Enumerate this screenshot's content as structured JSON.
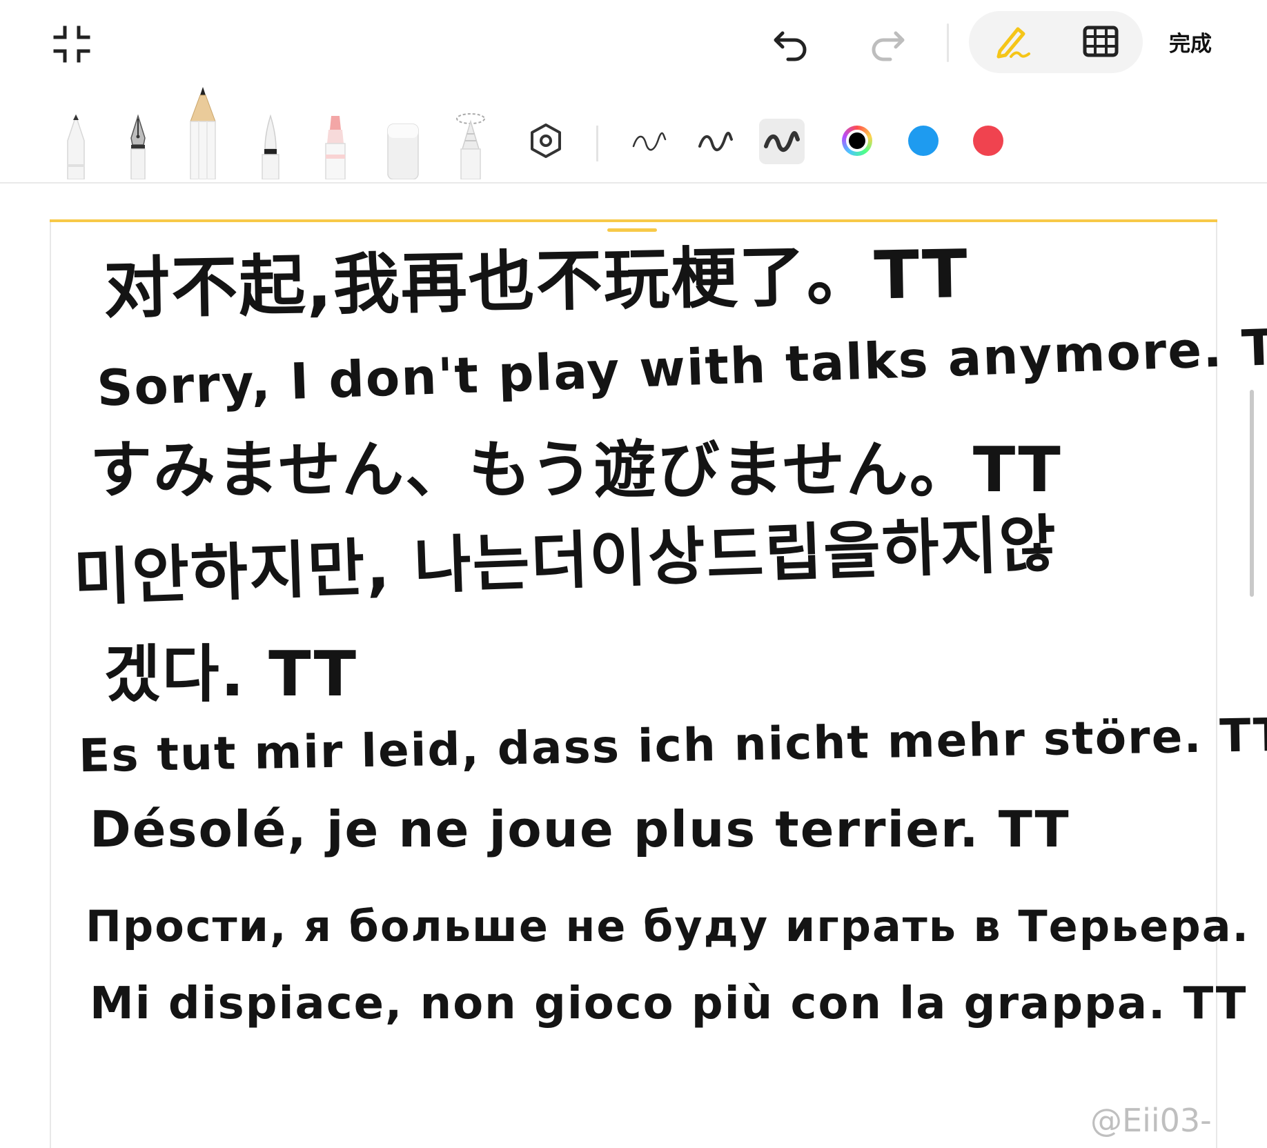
{
  "toolbar": {
    "collapse_icon": "collapse-icon",
    "undo_icon": "undo-icon",
    "redo_icon": "redo-icon",
    "pen_mode_icon": "handwriting-pen-icon",
    "grid_mode_icon": "grid-icon",
    "done_label": "完成",
    "accent_color": "#F5C518"
  },
  "tools": [
    {
      "name": "ballpoint-pen-tool",
      "icon": "ballpoint-pen-icon"
    },
    {
      "name": "fountain-pen-tool",
      "icon": "fountain-pen-icon"
    },
    {
      "name": "pencil-tool",
      "icon": "pencil-icon",
      "selected": true
    },
    {
      "name": "brush-pen-tool",
      "icon": "brush-pen-icon"
    },
    {
      "name": "highlighter-tool",
      "icon": "highlighter-icon"
    },
    {
      "name": "eraser-tool",
      "icon": "eraser-icon"
    },
    {
      "name": "lasso-tool",
      "icon": "lasso-icon"
    },
    {
      "name": "pen-settings",
      "icon": "settings-hexagon-icon"
    }
  ],
  "stroke_widths": [
    {
      "name": "stroke-thin",
      "selected": false
    },
    {
      "name": "stroke-medium",
      "selected": false
    },
    {
      "name": "stroke-thick",
      "selected": true
    }
  ],
  "colors": [
    {
      "name": "color-black",
      "hex": "#000000",
      "selected": true
    },
    {
      "name": "color-blue",
      "hex": "#1E9BF0",
      "selected": false
    },
    {
      "name": "color-red",
      "hex": "#F0434F",
      "selected": false
    }
  ],
  "note": {
    "lines": [
      "对不起,我再也不玩梗了。TT",
      "Sorry, I don't play with talks anymore. TT",
      "すみません、もう遊びません。TT",
      "미안하지만, 나는더이상드립을하지않",
      "겠다. TT",
      "Es tut mir leid, dass ich nicht mehr störe. TT",
      "Désolé, je ne joue plus terrier. TT",
      "Прости, я больше не буду играть в Терьера.",
      "Mi dispiace, non gioco più con la grappa. TT"
    ]
  },
  "watermark": "@Eii03-"
}
